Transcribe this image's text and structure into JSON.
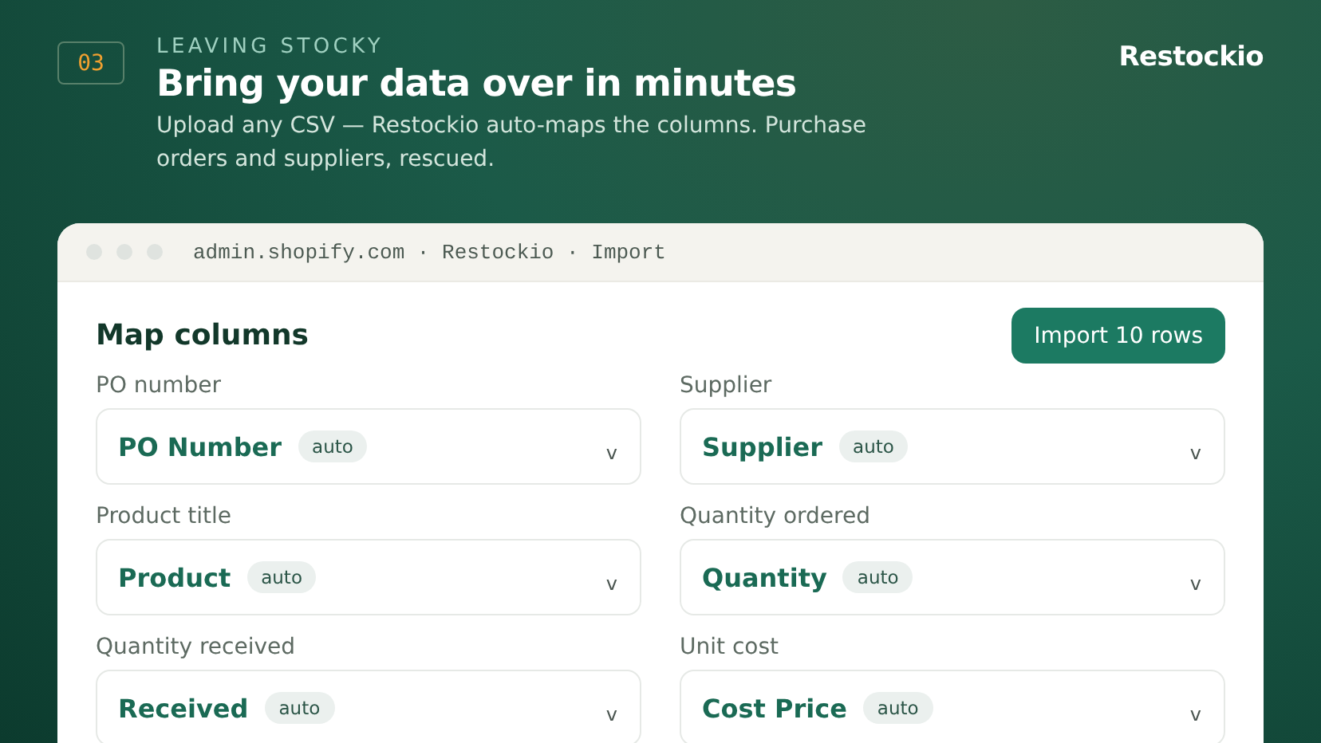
{
  "step": "03",
  "eyebrow": "LEAVING STOCKY",
  "headline": "Bring your data over in minutes",
  "subtitle": "Upload any CSV — Restockio auto-maps the columns. Purchase orders and suppliers, rescued.",
  "brand": "Restockio",
  "window": {
    "address": "admin.shopify.com · Restockio · Import",
    "title": "Map columns",
    "button": "Import 10 rows",
    "fields": [
      {
        "label": "PO number",
        "value": "PO Number",
        "badge": "auto",
        "caret": "v"
      },
      {
        "label": "Supplier",
        "value": "Supplier",
        "badge": "auto",
        "caret": "v"
      },
      {
        "label": "Product title",
        "value": "Product",
        "badge": "auto",
        "caret": "v"
      },
      {
        "label": "Quantity ordered",
        "value": "Quantity",
        "badge": "auto",
        "caret": "v"
      },
      {
        "label": "Quantity received",
        "value": "Received",
        "badge": "auto",
        "caret": "v"
      },
      {
        "label": "Unit cost",
        "value": "Cost Price",
        "badge": "auto",
        "caret": "v"
      }
    ]
  }
}
